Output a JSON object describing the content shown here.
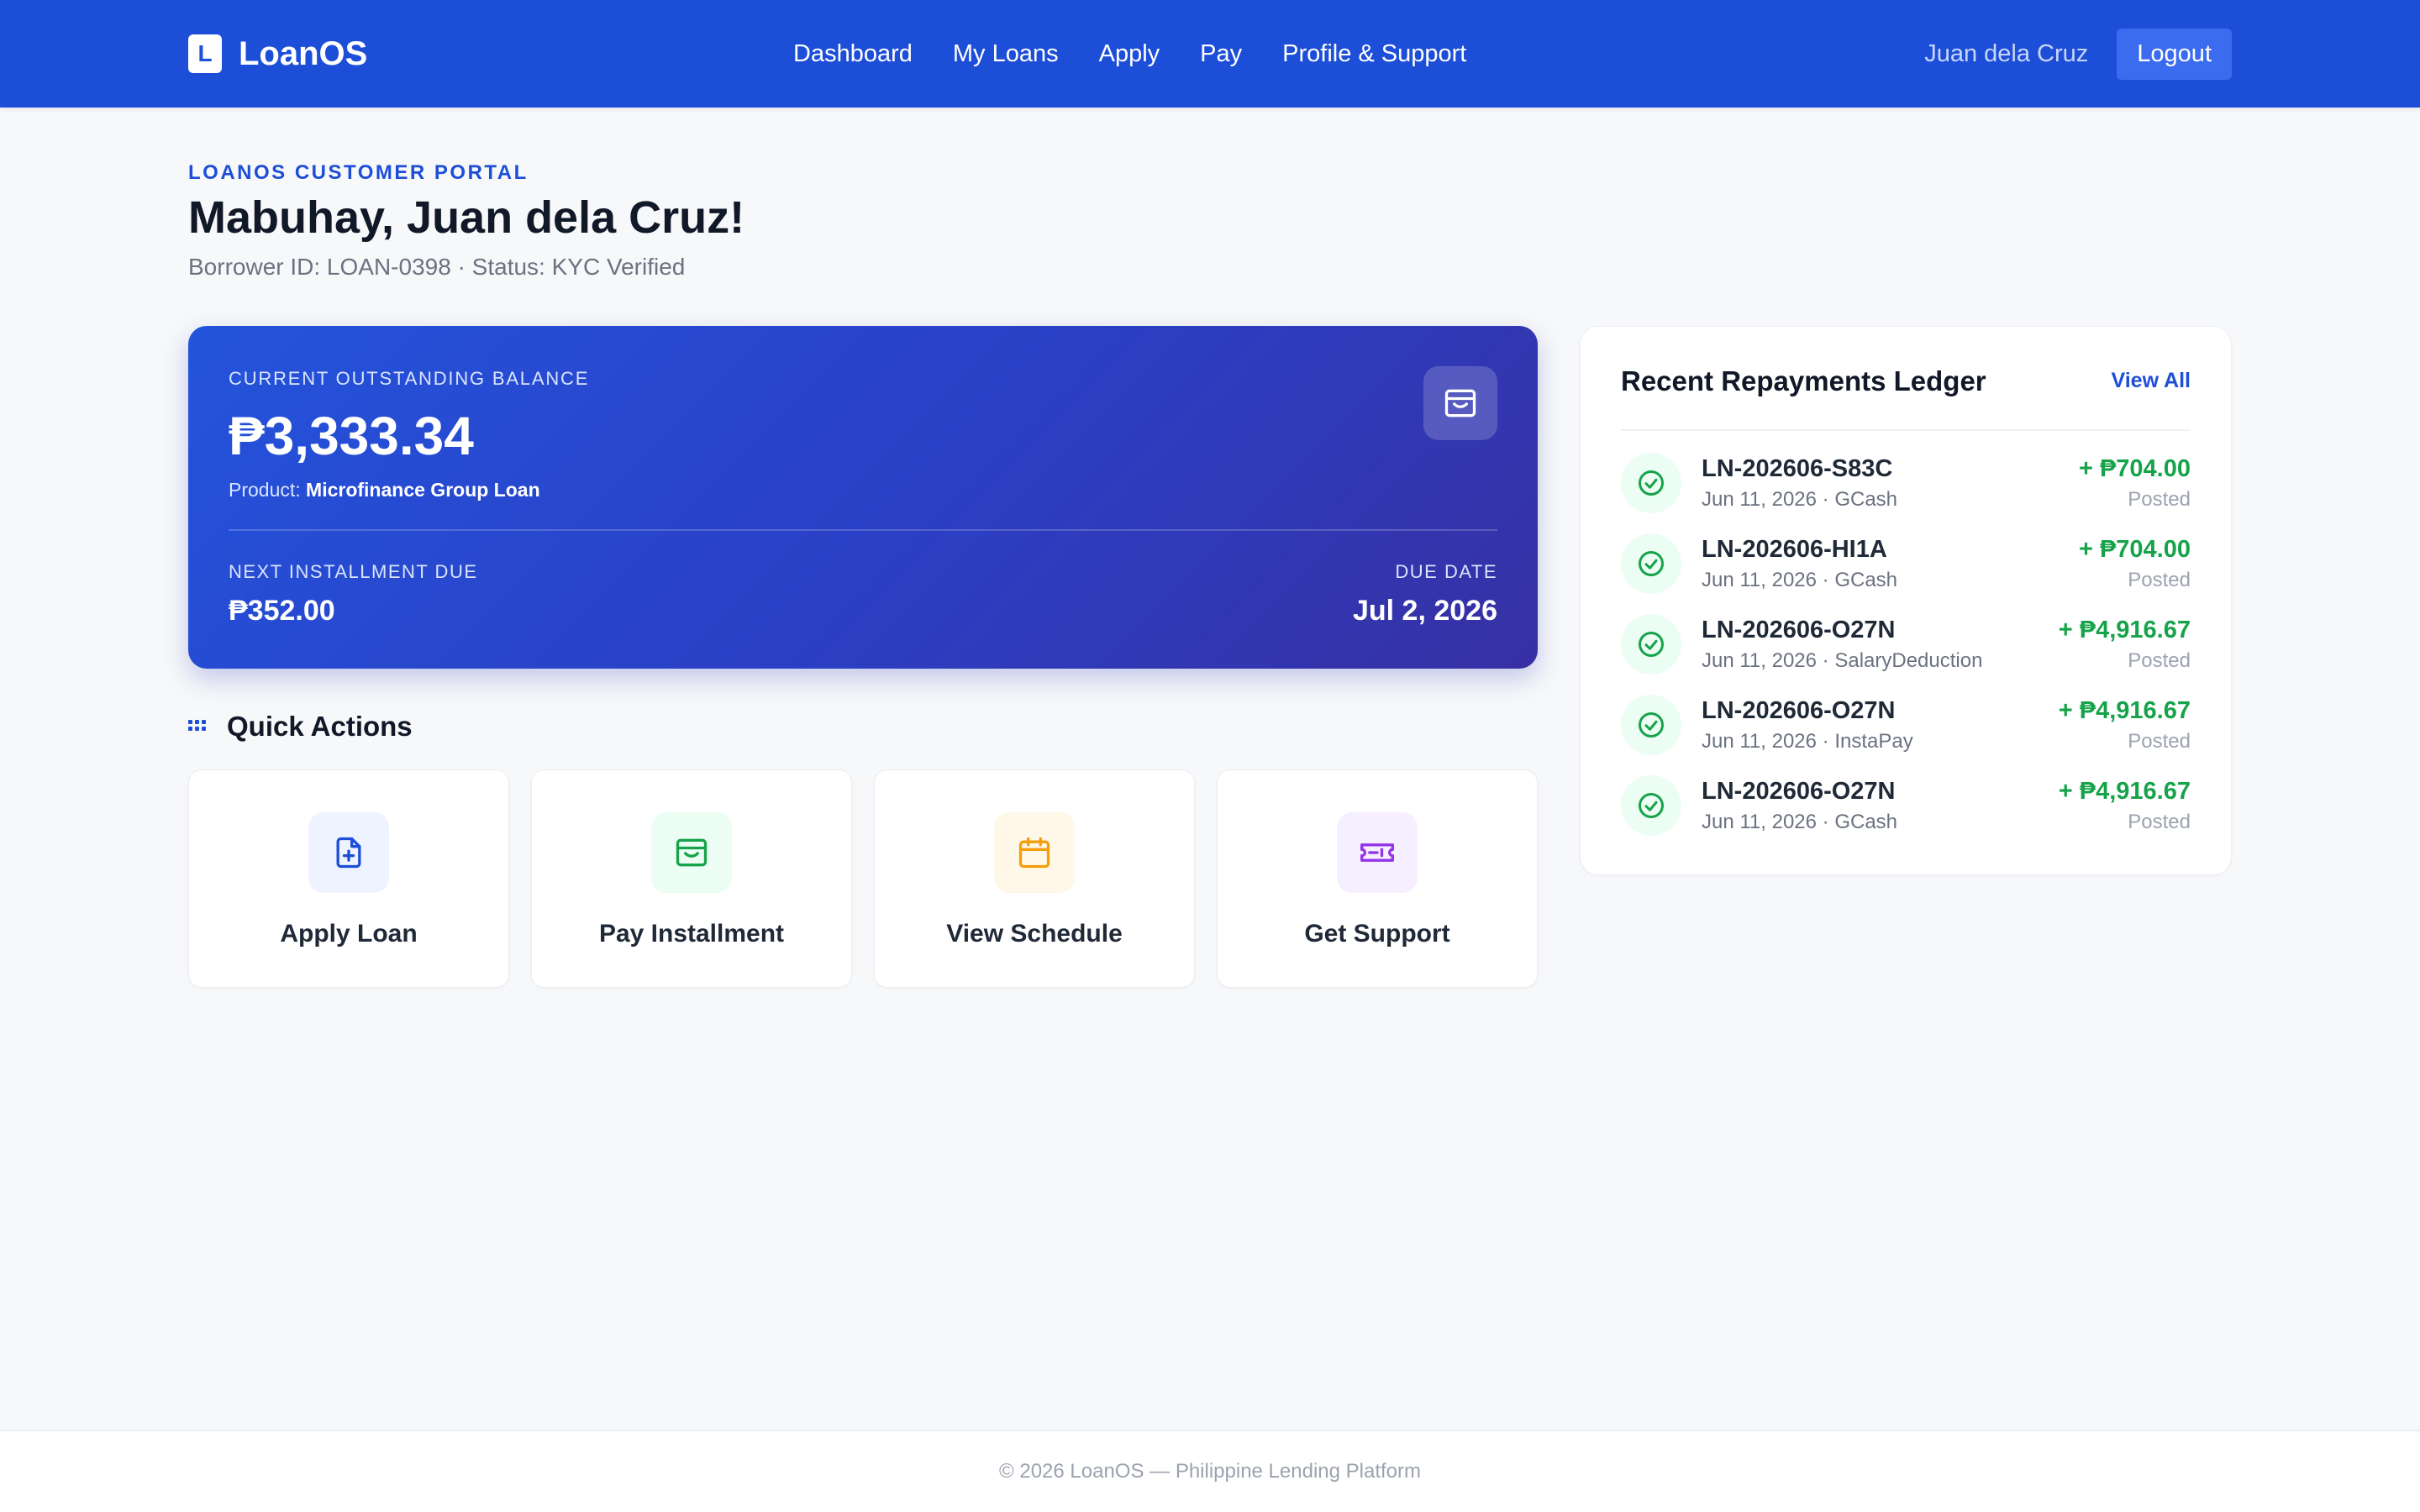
{
  "header": {
    "brand_letter": "L",
    "brand_name": "LoanOS",
    "nav": [
      "Dashboard",
      "My Loans",
      "Apply",
      "Pay",
      "Profile & Support"
    ],
    "user_name": "Juan dela Cruz",
    "logout_label": "Logout",
    "color": "#1d4ed8"
  },
  "intro": {
    "eyebrow": "LOANOS CUSTOMER PORTAL",
    "greeting": "Mabuhay, Juan dela Cruz!",
    "meta": "Borrower ID: LOAN-0398 · Status: KYC Verified"
  },
  "balance": {
    "label": "CURRENT OUTSTANDING BALANCE",
    "amount": "₱3,333.34",
    "product_prefix": "Product: ",
    "product": "Microfinance Group Loan",
    "icon": "wallet-icon",
    "next_label": "NEXT INSTALLMENT DUE",
    "next_amount": "₱352.00",
    "due_label": "DUE DATE",
    "due_date": "Jul 2, 2026"
  },
  "quick_actions": {
    "title": "Quick Actions",
    "items": [
      {
        "label": "Apply Loan",
        "icon": "file-plus-icon",
        "color": "#1d4ed8",
        "bg": "#eef3ff"
      },
      {
        "label": "Pay Installment",
        "icon": "wallet-icon",
        "color": "#16a34a",
        "bg": "#ecfdf3"
      },
      {
        "label": "View Schedule",
        "icon": "calendar-icon",
        "color": "#f59e0b",
        "bg": "#fff8e8"
      },
      {
        "label": "Get Support",
        "icon": "ticket-icon",
        "color": "#9333ea",
        "bg": "#f6efff"
      }
    ]
  },
  "ledger": {
    "title": "Recent Repayments Ledger",
    "view_all": "View All",
    "rows": [
      {
        "ref": "LN-202606-S83C",
        "sub": "Jun 11, 2026 · GCash",
        "amount": "+ ₱704.00",
        "status": "Posted"
      },
      {
        "ref": "LN-202606-HI1A",
        "sub": "Jun 11, 2026 · GCash",
        "amount": "+ ₱704.00",
        "status": "Posted"
      },
      {
        "ref": "LN-202606-O27N",
        "sub": "Jun 11, 2026 · SalaryDeduction",
        "amount": "+ ₱4,916.67",
        "status": "Posted"
      },
      {
        "ref": "LN-202606-O27N",
        "sub": "Jun 11, 2026 · InstaPay",
        "amount": "+ ₱4,916.67",
        "status": "Posted"
      },
      {
        "ref": "LN-202606-O27N",
        "sub": "Jun 11, 2026 · GCash",
        "amount": "+ ₱4,916.67",
        "status": "Posted"
      }
    ]
  },
  "footer": {
    "text": "© 2026 LoanOS — Philippine Lending Platform"
  }
}
